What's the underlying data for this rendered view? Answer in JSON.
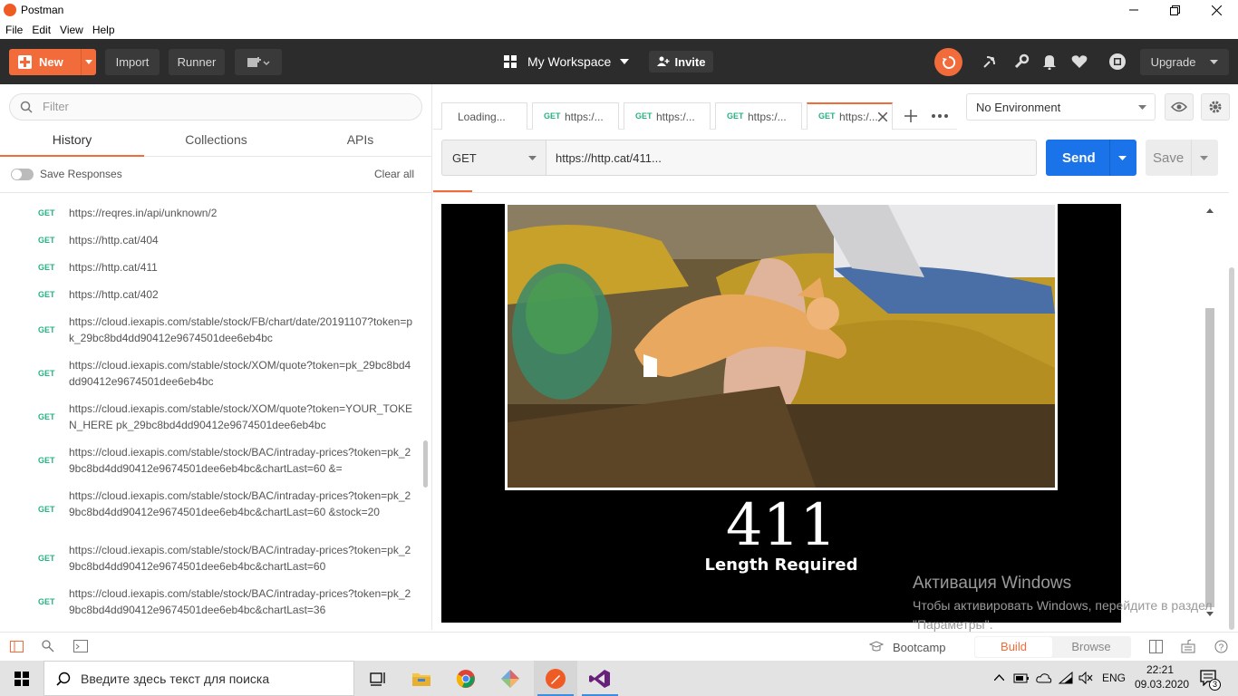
{
  "window": {
    "title": "Postman"
  },
  "menu": {
    "items": [
      "File",
      "Edit",
      "View",
      "Help"
    ]
  },
  "header": {
    "new_label": "New",
    "import_label": "Import",
    "runner_label": "Runner",
    "workspace_label": "My Workspace",
    "invite_label": "Invite",
    "upgrade_label": "Upgrade"
  },
  "sidebar": {
    "filter_placeholder": "Filter",
    "tabs": [
      "History",
      "Collections",
      "APIs"
    ],
    "save_responses_label": "Save Responses",
    "clear_all_label": "Clear all",
    "history": [
      {
        "method": "GET",
        "url": "https://reqres.in/api/unknown/2"
      },
      {
        "method": "GET",
        "url": "https://http.cat/404"
      },
      {
        "method": "GET",
        "url": "https://http.cat/411"
      },
      {
        "method": "GET",
        "url": "https://http.cat/402"
      },
      {
        "method": "GET",
        "url": "https://cloud.iexapis.com/stable/stock/FB/chart/date/20191107?token=pk_29bc8bd4dd90412e9674501dee6eb4bc"
      },
      {
        "method": "GET",
        "url": "https://cloud.iexapis.com/stable/stock/XOM/quote?token=pk_29bc8bd4dd90412e9674501dee6eb4bc"
      },
      {
        "method": "GET",
        "url": "https://cloud.iexapis.com/stable/stock/XOM/quote?token=YOUR_TOKEN_HERE pk_29bc8bd4dd90412e9674501dee6eb4bc"
      },
      {
        "method": "GET",
        "url": "https://cloud.iexapis.com/stable/stock/BAC/intraday-prices?token=pk_29bc8bd4dd90412e9674501dee6eb4bc&chartLast=60 &="
      },
      {
        "method": "GET",
        "url": "https://cloud.iexapis.com/stable/stock/BAC/intraday-prices?token=pk_29bc8bd4dd90412e9674501dee6eb4bc&chartLast=60 &stock=20"
      },
      {
        "method": "GET",
        "url": "https://cloud.iexapis.com/stable/stock/BAC/intraday-prices?token=pk_29bc8bd4dd90412e9674501dee6eb4bc&chartLast=60"
      },
      {
        "method": "GET",
        "url": "https://cloud.iexapis.com/stable/stock/BAC/intraday-prices?token=pk_29bc8bd4dd90412e9674501dee6eb4bc&chartLast=36"
      }
    ]
  },
  "request_tabs": [
    {
      "method": "",
      "label": "Loading..."
    },
    {
      "method": "GET",
      "label": "https:/..."
    },
    {
      "method": "GET",
      "label": "https:/..."
    },
    {
      "method": "GET",
      "label": "https:/..."
    },
    {
      "method": "GET",
      "label": "https:/..."
    }
  ],
  "environment": {
    "selected": "No Environment"
  },
  "request": {
    "method": "GET",
    "url": "https://http.cat/411...",
    "send_label": "Send",
    "save_label": "Save"
  },
  "response": {
    "status_code": "411",
    "status_text": "Length Required"
  },
  "watermark": {
    "title": "Активация Windows",
    "text": "Чтобы активировать Windows, перейдите в раздел \"Параметры\"."
  },
  "statusbar": {
    "bootcamp_label": "Bootcamp",
    "build_label": "Build",
    "browse_label": "Browse"
  },
  "taskbar": {
    "search_text": "Введите здесь текст для поиска",
    "language": "ENG",
    "time": "22:21",
    "date": "09.03.2020",
    "notification_count": "3"
  },
  "colors": {
    "accent": "#f26b3a",
    "send_blue": "#1a73e8",
    "get_green": "#26b47f",
    "header_dark": "#2c2c2c"
  }
}
